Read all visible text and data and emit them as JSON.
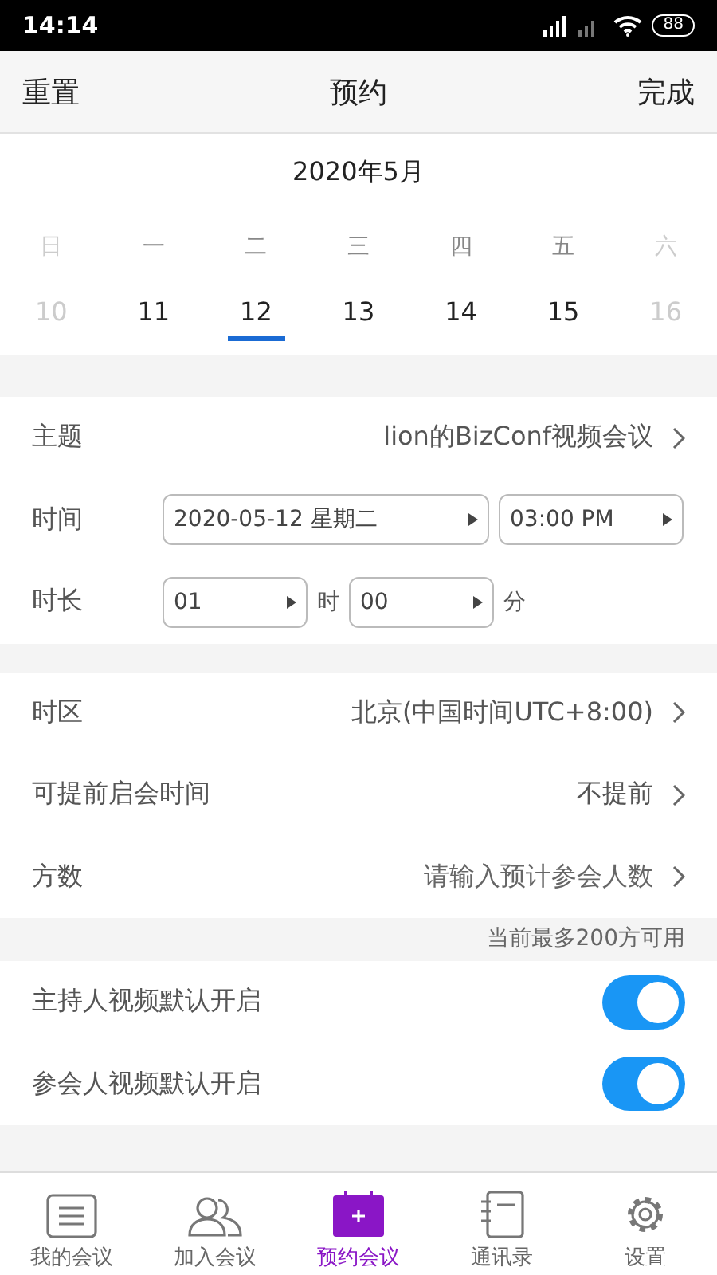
{
  "status_bar": {
    "time": "14:14",
    "battery": "88"
  },
  "header": {
    "left": "重置",
    "title": "预约",
    "right": "完成"
  },
  "calendar": {
    "month": "2020年5月",
    "weekdays": [
      {
        "label": "日",
        "muted": true
      },
      {
        "label": "一",
        "muted": false
      },
      {
        "label": "二",
        "muted": false
      },
      {
        "label": "三",
        "muted": false
      },
      {
        "label": "四",
        "muted": false
      },
      {
        "label": "五",
        "muted": false
      },
      {
        "label": "六",
        "muted": true
      }
    ],
    "days": [
      {
        "label": "10",
        "muted": true,
        "selected": false
      },
      {
        "label": "11",
        "muted": false,
        "selected": false
      },
      {
        "label": "12",
        "muted": false,
        "selected": true
      },
      {
        "label": "13",
        "muted": false,
        "selected": false
      },
      {
        "label": "14",
        "muted": false,
        "selected": false
      },
      {
        "label": "15",
        "muted": false,
        "selected": false
      },
      {
        "label": "16",
        "muted": true,
        "selected": false
      }
    ]
  },
  "subject": {
    "label": "主题",
    "value": "lion的BizConf视频会议"
  },
  "time": {
    "label": "时间",
    "date": "2020-05-12 星期二",
    "clock": "03:00 PM"
  },
  "duration": {
    "label": "时长",
    "hours": "01",
    "hours_unit": "时",
    "minutes": "00",
    "minutes_unit": "分"
  },
  "settings": [
    {
      "label": "时区",
      "value": "北京(中国时间UTC+8:00)",
      "placeholder": false
    },
    {
      "label": "可提前启会时间",
      "value": "不提前",
      "placeholder": false
    },
    {
      "label": "方数",
      "value": "请输入预计参会人数",
      "placeholder": true
    }
  ],
  "note": "当前最多200方可用",
  "toggles": [
    {
      "label": "主持人视频默认开启",
      "on": true
    },
    {
      "label": "参会人视频默认开启",
      "on": true
    }
  ],
  "tabs": [
    {
      "label": "我的会议",
      "kind": "list",
      "selected": false
    },
    {
      "label": "加入会议",
      "kind": "people",
      "selected": false
    },
    {
      "label": "预约会议",
      "kind": "calendar",
      "selected": true
    },
    {
      "label": "通讯录",
      "kind": "book",
      "selected": false
    },
    {
      "label": "设置",
      "kind": "gear",
      "selected": false
    }
  ]
}
